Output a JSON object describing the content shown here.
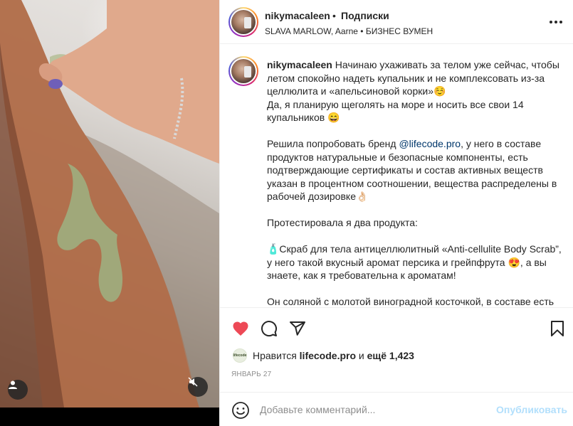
{
  "post": {
    "username": "nikymacaleen",
    "separator": "•",
    "follow_label": "Подписки",
    "audio": "SLAVA MARLOW, Aarne • БИЗНЕС ВУМЕН"
  },
  "caption": {
    "author": "nikymacaleen",
    "p1": " Начинаю ухаживать за телом уже сейчас, чтобы летом спокойно надеть купальник и не комплексовать из-за целлюлита и «апельсиновой корки»☺️\nДа, я планирую щеголять на море и носить все свои 14 купальников 😄\n\nРешила попробовать бренд ",
    "mention": "@lifecode.pro",
    "p2": ", у него в составе продуктов натуральные и безопасные компоненты, есть подтверждающие сертификаты и состав активных веществ указан в процентном соотношении, вещества распределены в рабочей дозировке👌🏻\n\nПротестировала я два продукта:\n\n🧴Скраб для тела антицеллюлитный «Anti-cellulite Body Scrab”, у него такой вкусный аромат персика и грейпфрута 😍, а вы знаете, как я требовательна к ароматам!\n\nОн соляной с молотой виноградной косточкой, в составе есть"
  },
  "likes": {
    "prefix": "Нравится ",
    "user": "lifecode.pro",
    "middle": " и ",
    "count": "ещё 1,423",
    "avatar_text": "lifecode"
  },
  "date": "ЯНВАРЬ 27",
  "comment": {
    "placeholder": "Добавьте комментарий...",
    "publish_label": "Опубликовать"
  },
  "icons": {
    "like": "heart-filled-icon",
    "comment": "comment-icon",
    "share": "share-icon",
    "save": "bookmark-icon",
    "emoji": "emoji-icon",
    "more": "more-options-icon",
    "user_tag": "user-tag-icon",
    "mute": "speaker-muted-icon"
  },
  "colors": {
    "like": "#ed4956",
    "mention": "#00376b",
    "publish_disabled": "#b2dffc",
    "secondary_text": "#8e8e8e"
  }
}
